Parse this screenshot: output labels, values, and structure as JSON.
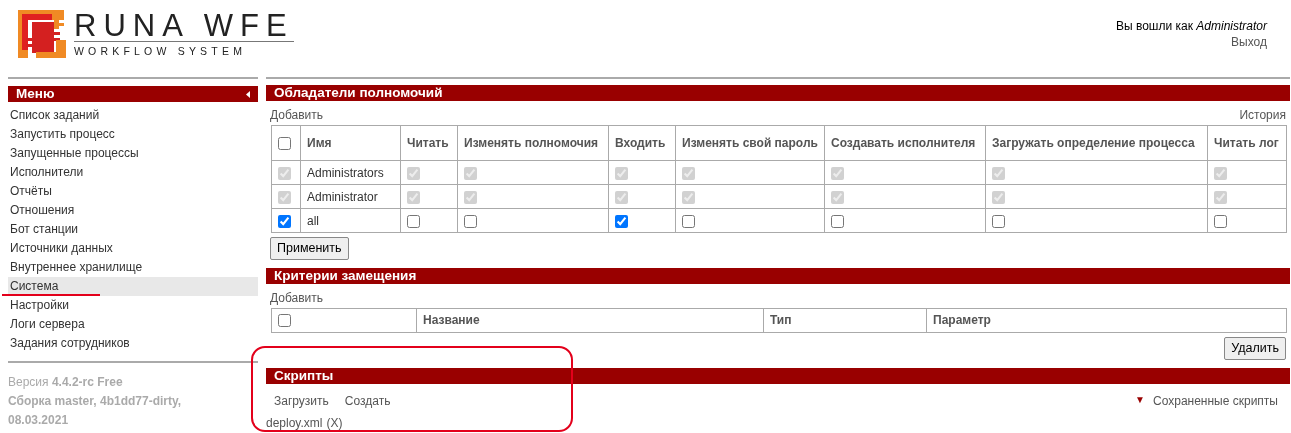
{
  "header": {
    "logo": {
      "title": "RUNA WFE",
      "subtitle": "WORKFLOW SYSTEM"
    },
    "user": {
      "greeting": "Вы вошли как *Administrator*",
      "logout": "Выход"
    }
  },
  "sidebar": {
    "title": "Меню",
    "items": [
      {
        "label": "Список заданий",
        "selected": false,
        "underlined": false
      },
      {
        "label": "Запустить процесс",
        "selected": false,
        "underlined": false
      },
      {
        "label": "Запущенные процессы",
        "selected": false,
        "underlined": false
      },
      {
        "label": "Исполнители",
        "selected": false,
        "underlined": false
      },
      {
        "label": "Отчёты",
        "selected": false,
        "underlined": false
      },
      {
        "label": "Отношения",
        "selected": false,
        "underlined": false
      },
      {
        "label": "Бот станции",
        "selected": false,
        "underlined": false
      },
      {
        "label": "Источники данных",
        "selected": false,
        "underlined": false
      },
      {
        "label": "Внутреннее хранилище",
        "selected": false,
        "underlined": false
      },
      {
        "label": "Система",
        "selected": true,
        "underlined": true
      },
      {
        "label": "Настройки",
        "selected": false,
        "underlined": false
      },
      {
        "label": "Логи сервера",
        "selected": false,
        "underlined": false
      },
      {
        "label": "Задания сотрудников",
        "selected": false,
        "underlined": false
      }
    ],
    "version": "Версия **4.4.2-rc Free**",
    "build": "Сборка master, 4b1dd77-dirty, 08.03.2021"
  },
  "permissions": {
    "title": "Обладатели полномочий",
    "add_link": "Добавить",
    "history_link": "История",
    "select_all": {
      "checked": false
    },
    "columns": [
      "Имя",
      "Читать",
      "Изменять полномочия",
      "Входить",
      "Изменять свой пароль",
      "Создавать исполнителя",
      "Загружать определение процесса",
      "Читать лог"
    ],
    "rows": [
      {
        "name": "Administrators",
        "select": {
          "checked": true,
          "disabled": true
        },
        "perms": [
          {
            "checked": true,
            "disabled": true
          },
          {
            "checked": true,
            "disabled": true
          },
          {
            "checked": true,
            "disabled": true
          },
          {
            "checked": true,
            "disabled": true
          },
          {
            "checked": true,
            "disabled": true
          },
          {
            "checked": true,
            "disabled": true
          },
          {
            "checked": true,
            "disabled": true
          }
        ]
      },
      {
        "name": "Administrator",
        "select": {
          "checked": true,
          "disabled": true
        },
        "perms": [
          {
            "checked": true,
            "disabled": true
          },
          {
            "checked": true,
            "disabled": true
          },
          {
            "checked": true,
            "disabled": true
          },
          {
            "checked": true,
            "disabled": true
          },
          {
            "checked": true,
            "disabled": true
          },
          {
            "checked": true,
            "disabled": true
          },
          {
            "checked": true,
            "disabled": true
          }
        ]
      },
      {
        "name": "all",
        "select": {
          "checked": true,
          "disabled": false
        },
        "perms": [
          {
            "checked": false,
            "disabled": false
          },
          {
            "checked": false,
            "disabled": false
          },
          {
            "checked": true,
            "disabled": false
          },
          {
            "checked": false,
            "disabled": false
          },
          {
            "checked": false,
            "disabled": false
          },
          {
            "checked": false,
            "disabled": false
          },
          {
            "checked": false,
            "disabled": false
          }
        ]
      }
    ],
    "apply_button": "Применить"
  },
  "substitution": {
    "title": "Критерии замещения",
    "add_link": "Добавить",
    "select_all": {
      "checked": false
    },
    "columns": [
      "Название",
      "Тип",
      "Параметр"
    ],
    "delete_button": "Удалить"
  },
  "scripts": {
    "title": "Скрипты",
    "outlined": true,
    "actions": [
      "Загрузить",
      "Создать"
    ],
    "saved_scripts": {
      "icon": "▼",
      "label": "Сохраненные скрипты"
    },
    "files": [
      {
        "name": "deploy.xml",
        "remove": "(X)"
      }
    ]
  }
}
